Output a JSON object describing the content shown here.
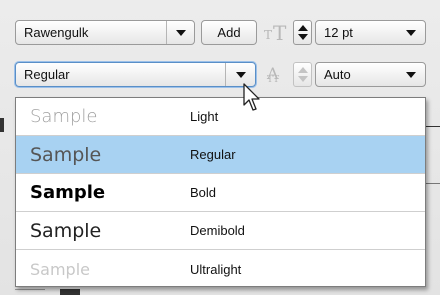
{
  "toolbar": {
    "font_family": "Rawengulk",
    "add_label": "Add",
    "font_size": "12 pt",
    "font_style": "Regular",
    "line_spacing": "Auto"
  },
  "menu": {
    "items": [
      {
        "sample": "Sample",
        "weight": "Light",
        "selected": false
      },
      {
        "sample": "Sample",
        "weight": "Regular",
        "selected": true
      },
      {
        "sample": "Sample",
        "weight": "Bold",
        "selected": false
      },
      {
        "sample": "Sample",
        "weight": "Demibold",
        "selected": false
      },
      {
        "sample": "Sample",
        "weight": "Ultralight",
        "selected": false
      }
    ]
  },
  "icons": [
    "text-size-icon",
    "line-spacing-icon",
    "mouse-cursor-icon",
    "chevron-down-icon"
  ],
  "colors": {
    "selection": "#a8d2f2",
    "focus_ring": "#5a8fc7"
  }
}
